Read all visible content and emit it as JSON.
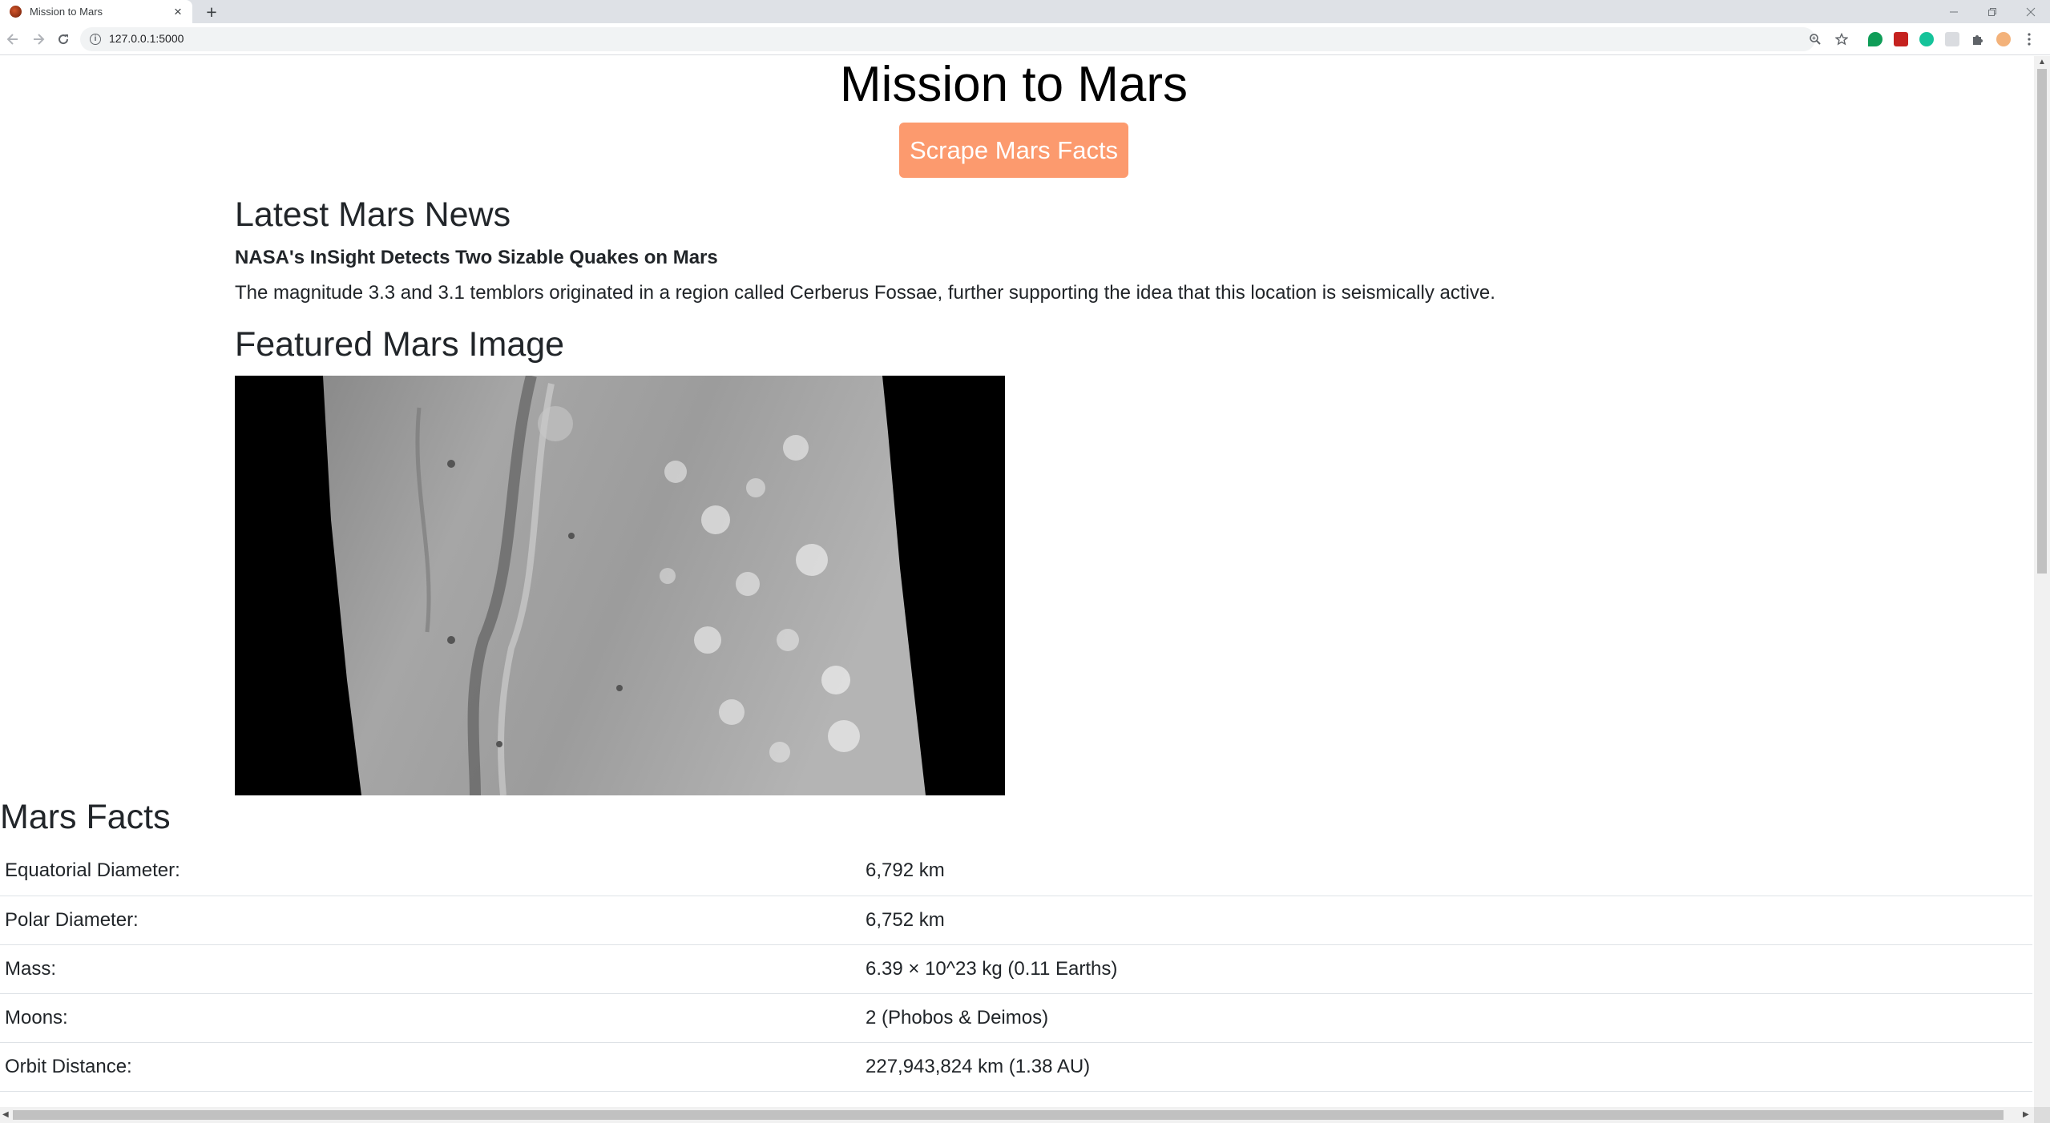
{
  "browser": {
    "tab_title": "Mission to Mars",
    "url": "127.0.0.1:5000"
  },
  "page": {
    "title": "Mission to Mars",
    "scrape_button": "Scrape Mars Facts",
    "news": {
      "heading": "Latest Mars News",
      "title": "NASA's InSight Detects Two Sizable Quakes on Mars",
      "paragraph": "The magnitude 3.3 and 3.1 temblors originated in a region called Cerberus Fossae, further supporting the idea that this location is seismically active."
    },
    "featured": {
      "heading": "Featured Mars Image"
    },
    "facts": {
      "heading": "Mars Facts",
      "rows": [
        {
          "label": "Equatorial Diameter:",
          "value": "6,792 km"
        },
        {
          "label": "Polar Diameter:",
          "value": "6,752 km"
        },
        {
          "label": "Mass:",
          "value": "6.39 × 10^23 kg (0.11 Earths)"
        },
        {
          "label": "Moons:",
          "value": "2 (Phobos & Deimos)"
        },
        {
          "label": "Orbit Distance:",
          "value": "227,943,824 km (1.38 AU)"
        }
      ]
    }
  },
  "colors": {
    "button": "#fc9a6e",
    "text": "#212529"
  }
}
